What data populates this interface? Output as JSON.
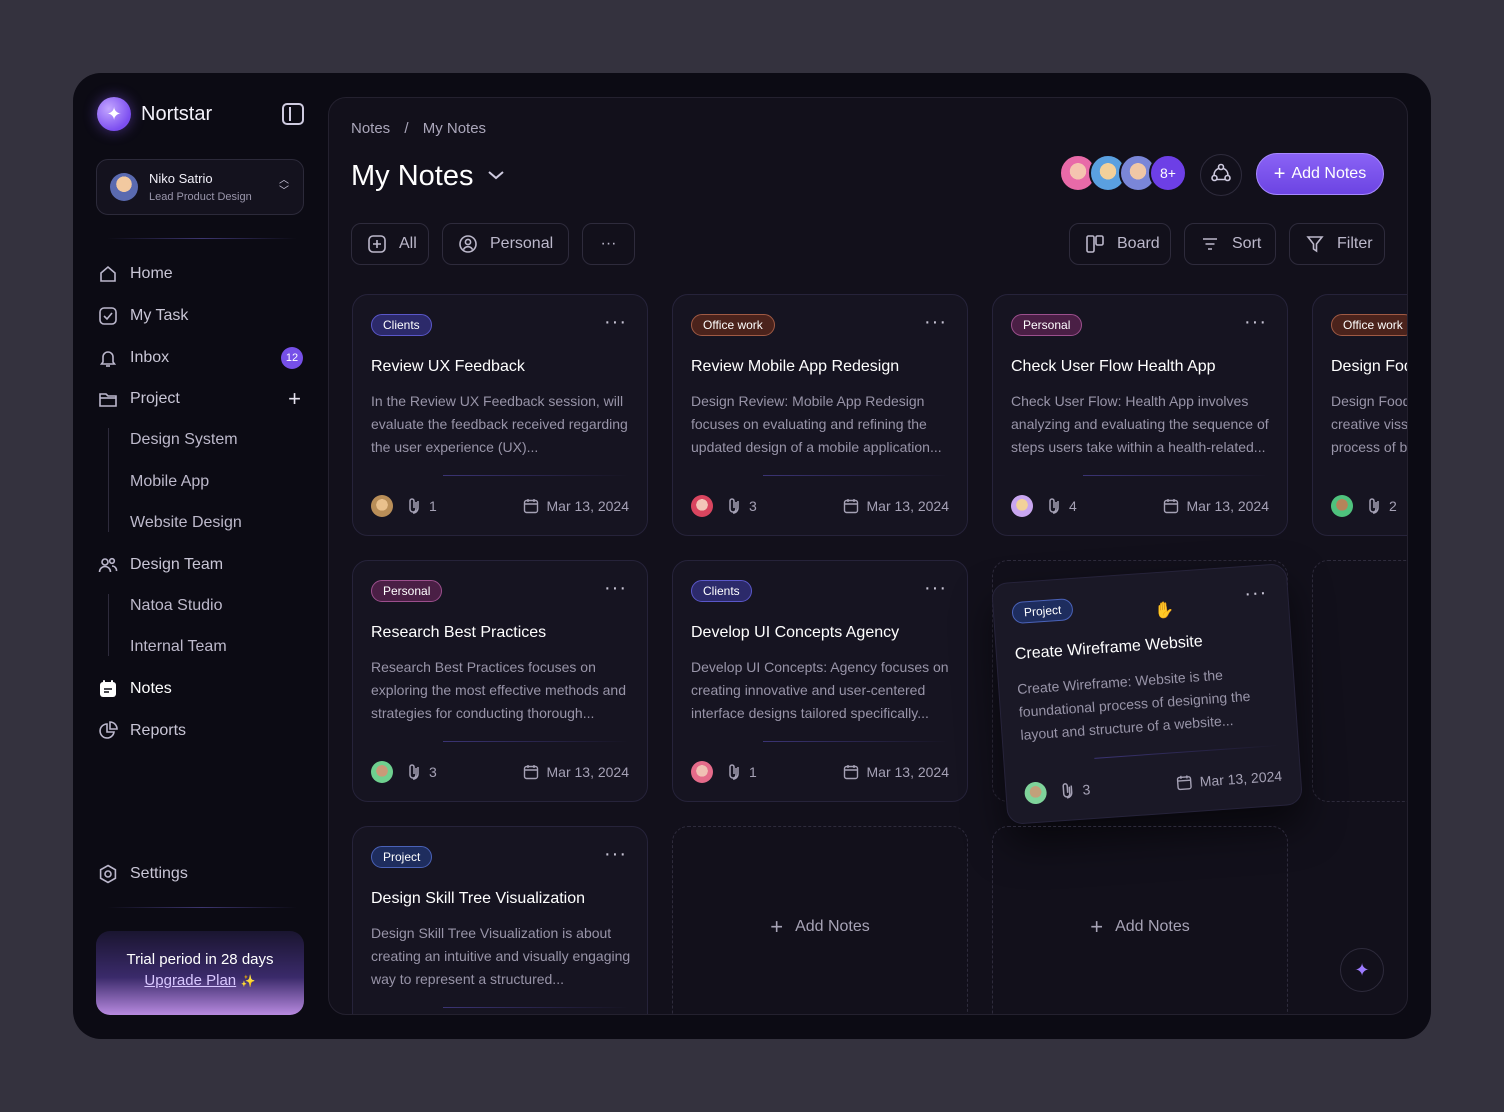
{
  "brand": {
    "name": "Nortstar"
  },
  "user": {
    "name": "Niko Satrio",
    "role": "Lead Product Design"
  },
  "nav": {
    "home": "Home",
    "my_task": "My Task",
    "inbox": "Inbox",
    "inbox_count": "12",
    "project": "Project",
    "project_children": [
      "Design System",
      "Mobile App",
      "Website Design"
    ],
    "design_team": "Design Team",
    "team_children": [
      "Natoa Studio",
      "Internal Team"
    ],
    "notes": "Notes",
    "reports": "Reports",
    "settings": "Settings"
  },
  "trial": {
    "title": "Trial period in 28 days",
    "link": "Upgrade Plan"
  },
  "breadcrumb": [
    "Notes",
    "/",
    "My Notes"
  ],
  "page": {
    "title": "My Notes",
    "more_count": "8+",
    "add_label": "Add Notes"
  },
  "filters": {
    "all": "All",
    "personal": "Personal",
    "more": "···"
  },
  "view": {
    "board": "Board",
    "sort": "Sort",
    "filter": "Filter"
  },
  "cards": [
    {
      "tag": "Clients",
      "title": "Review UX Feedback",
      "desc": "In the Review UX Feedback session, will evaluate the feedback received regarding the user experience (UX)...",
      "count": "1",
      "date": "Mar 13, 2024"
    },
    {
      "tag": "Office work",
      "title": "Review Mobile App Redesign",
      "desc": "Design Review: Mobile App Redesign focuses on evaluating and refining the updated design of a mobile application...",
      "count": "3",
      "date": "Mar 13, 2024"
    },
    {
      "tag": "Personal",
      "title": "Check User Flow Health App",
      "desc": "Check User Flow: Health App involves analyzing and evaluating the sequence of steps users take within a health-related...",
      "count": "4",
      "date": "Mar 13, 2024"
    },
    {
      "tag": "Office work",
      "title": "Design Fod",
      "desc": "Design Food creative viss process of b",
      "count": "2",
      "date": ""
    },
    {
      "tag": "Personal",
      "title": "Research Best Practices",
      "desc": "Research Best Practices focuses on exploring the most effective methods and strategies for conducting thorough...",
      "count": "3",
      "date": "Mar 13, 2024"
    },
    {
      "tag": "Clients",
      "title": "Develop UI Concepts Agency",
      "desc": "Develop UI Concepts: Agency focuses on creating innovative and user-centered interface designs tailored specifically...",
      "count": "1",
      "date": "Mar 13, 2024"
    },
    {
      "tag": "Project",
      "title": "Create Wireframe Website",
      "desc": "Create Wireframe: Website is the foundational process of designing the layout and structure of a website...",
      "count": "3",
      "date": "Mar 13, 2024"
    },
    {
      "tag": "Project",
      "title": "Design Skill Tree Visualization",
      "desc": "Design Skill Tree Visualization is about creating an intuitive and visually engaging way to represent a structured...",
      "count": "",
      "date": ""
    }
  ],
  "add_slot_label": "Add Notes",
  "colors": {
    "accent": "#7650e8",
    "background": "#0c0b14"
  }
}
